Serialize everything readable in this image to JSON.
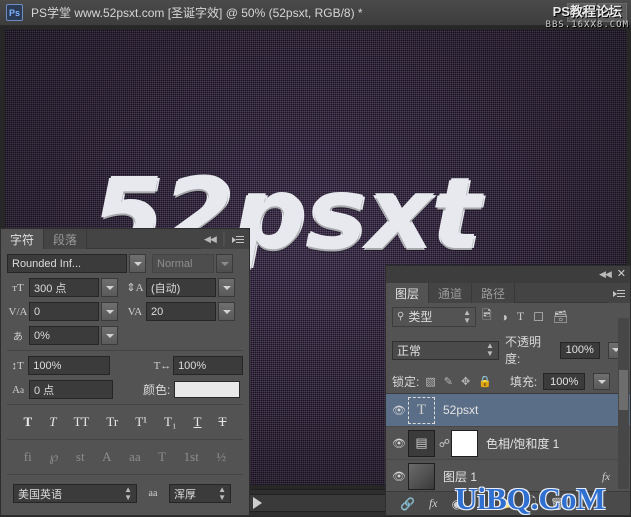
{
  "window": {
    "app_icon": "Ps",
    "title": "PS学堂 www.52psxt.com [圣诞字效] @ 50% (52psxt, RGB/8) *",
    "minimize_label": "—",
    "restore_label": "❐"
  },
  "canvas": {
    "artwork_text": "52psxt",
    "background_color": "#3a2b48",
    "text_color": "#e7e9ee"
  },
  "watermarks": {
    "top_line1": "PS教程论坛",
    "top_line2": "BBS.16XX8.COM",
    "bottom": "UiBQ.CoM"
  },
  "character_panel": {
    "tabs": [
      {
        "label": "字符",
        "active": true
      },
      {
        "label": "段落",
        "active": false
      }
    ],
    "collapse_icon": "◀◀",
    "menu_icon": "panel-menu-icon",
    "font_family": "Rounded Inf...",
    "font_style": "Normal",
    "font_size_icon": "size-icon",
    "font_size": "300 点",
    "leading_icon": "leading-icon",
    "leading": "(自动)",
    "kerning_icon": "kerning-icon",
    "kerning": "0",
    "tracking_icon": "tracking-icon",
    "tracking": "20",
    "scaling_icon": "vertical-scale-icon",
    "scaling": "0%",
    "vscale_icon": "vertical-scale-icon",
    "vertical_scale": "100%",
    "hscale_icon": "horizontal-scale-icon",
    "horizontal_scale": "100%",
    "baseline_icon": "baseline-shift-icon",
    "baseline_shift": "0 点",
    "color_label": "颜色:",
    "color_value": "#e9e9e9",
    "style_buttons": [
      "T",
      "T",
      "TT",
      "Tr",
      "T¹",
      "T₁",
      "T",
      "T"
    ],
    "ot_buttons": [
      "fi",
      "℘",
      "st",
      "A",
      "aa",
      "T",
      "1st",
      "½"
    ],
    "language": "美国英语",
    "aa_icon": "aa",
    "antialias": "浑厚"
  },
  "layers_panel": {
    "collapse_icon": "◀◀",
    "close_icon": "✕",
    "menu_icon": "panel-menu-icon",
    "tabs": [
      {
        "label": "图层",
        "active": true
      },
      {
        "label": "通道",
        "active": false
      },
      {
        "label": "路径",
        "active": false
      }
    ],
    "filter_icon": "search-icon",
    "filter_kind": "类型",
    "filter_type_icons": [
      "image-filter-icon",
      "adjustment-filter-icon",
      "type-filter-icon",
      "shape-filter-icon",
      "smart-object-filter-icon"
    ],
    "blend_mode": "正常",
    "opacity_label": "不透明度:",
    "opacity_value": "100%",
    "lock_label": "锁定:",
    "lock_icons": [
      "lock-transparency-icon",
      "lock-pixels-icon",
      "lock-position-icon",
      "lock-all-icon"
    ],
    "fill_label": "填充:",
    "fill_value": "100%",
    "layers": [
      {
        "name": "52psxt",
        "thumb": "T",
        "thumb_kind": "text",
        "visible": true,
        "selected": true,
        "has_mask": false,
        "has_fx": false
      },
      {
        "name": "色相/饱和度 1",
        "thumb": "adjustment",
        "thumb_kind": "adjustment",
        "visible": true,
        "selected": false,
        "has_mask": true,
        "has_fx": false
      },
      {
        "name": "图层 1",
        "thumb": "gradient",
        "thumb_kind": "pixel",
        "visible": true,
        "selected": false,
        "has_mask": false,
        "has_fx": true,
        "fx_label": "fx"
      }
    ],
    "footer_icons": [
      "link-layers-icon",
      "layer-style-fx-icon",
      "add-mask-icon",
      "new-adjustment-icon",
      "new-group-icon",
      "new-layer-icon",
      "delete-layer-icon"
    ]
  },
  "statusbar": {
    "play_icon": "play-icon"
  }
}
